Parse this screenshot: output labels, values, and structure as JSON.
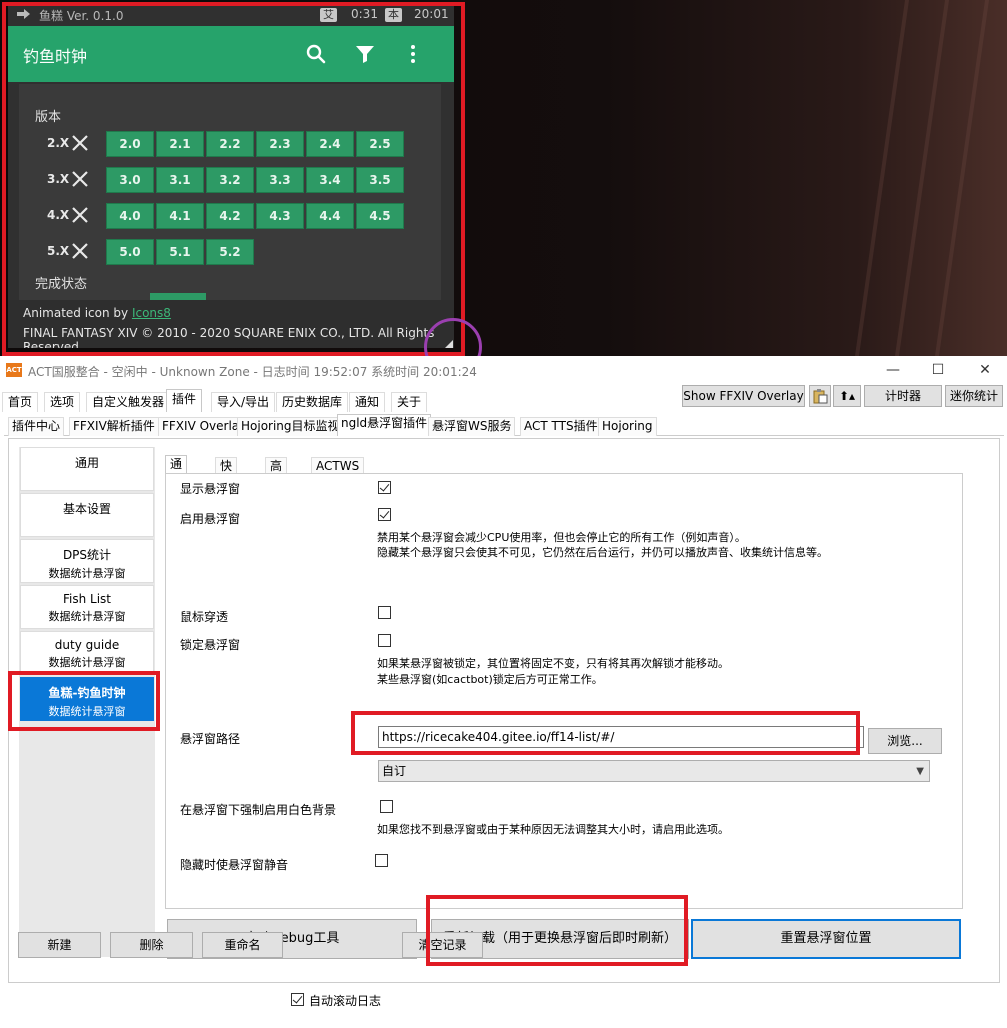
{
  "overlay": {
    "app_title": "鱼糕 Ver. 0.1.0",
    "tag_et": "艾",
    "time_et": "0:31",
    "tag_lt": "本",
    "time_lt": "20:01",
    "header_title": "钓鱼时钟",
    "version_label": "版本",
    "version_rows": [
      {
        "name": "2.X",
        "versions": [
          "2.0",
          "2.1",
          "2.2",
          "2.3",
          "2.4",
          "2.5"
        ]
      },
      {
        "name": "3.X",
        "versions": [
          "3.0",
          "3.1",
          "3.2",
          "3.3",
          "3.4",
          "3.5"
        ]
      },
      {
        "name": "4.X",
        "versions": [
          "4.0",
          "4.1",
          "4.2",
          "4.3",
          "4.4",
          "4.5"
        ]
      },
      {
        "name": "5.X",
        "versions": [
          "5.0",
          "5.1",
          "5.2"
        ]
      }
    ],
    "completion_label": "完成状态",
    "footer_prefix": "Animated icon by ",
    "footer_link": "Icons8",
    "footer_copyright": "FINAL FANTASY XIV © 2010 - 2020 SQUARE ENIX CO., LTD. All Rights Reserved.",
    "icons": [
      "arrow-right-icon",
      "search-icon",
      "filter-icon",
      "more-vert-icon",
      "close-icon",
      "resize-grip-icon"
    ],
    "accent_color": "#26a36b"
  },
  "act": {
    "window_title": "ACT国服整合 - 空闲中 - Unknown Zone - 日志时间 19:52:07 系统时间 20:01:24",
    "logo_text": "ACT",
    "menu_tabs": [
      "首页",
      "选项",
      "自定义触发器",
      "插件",
      "导入/导出",
      "历史数据库",
      "通知",
      "关于"
    ],
    "right_buttons": {
      "show_overlay": "Show FFXIV Overlay",
      "timer": "计时器",
      "mini": "迷你统计"
    },
    "plugin_tabs": [
      "插件中心",
      "FFXIV解析插件",
      "FFXIV Overlay",
      "Hojoring目标监视",
      "ngld悬浮窗插件",
      "悬浮窗WS服务",
      "ACT TTS插件",
      "Hojoring"
    ],
    "overlays": [
      {
        "title": "通用",
        "subtitle": ""
      },
      {
        "title": "基本设置",
        "subtitle": ""
      },
      {
        "title": "DPS统计",
        "subtitle": "数据统计悬浮窗"
      },
      {
        "title": "Fish List",
        "subtitle": "数据统计悬浮窗"
      },
      {
        "title": "duty guide",
        "subtitle": "数据统计悬浮窗"
      },
      {
        "title": "鱼糕-钓鱼时钟",
        "subtitle": "数据统计悬浮窗"
      }
    ],
    "inner_tabs": [
      "通用",
      "快捷键",
      "高级",
      "ACTWS"
    ],
    "settings": {
      "show_overlay_label": "显示悬浮窗",
      "enable_overlay_label": "启用悬浮窗",
      "enable_desc_1": "禁用某个悬浮窗会减少CPU使用率，但也会停止它的所有工作（例如声音）。",
      "enable_desc_2": "隐藏某个悬浮窗只会使其不可见，它仍然在后台运行，并仍可以播放声音、收集统计信息等。",
      "click_through_label": "鼠标穿透",
      "lock_label": "锁定悬浮窗",
      "lock_desc_1": "如果某悬浮窗被锁定，其位置将固定不变，只有将其再次解锁才能移动。",
      "lock_desc_2": "某些悬浮窗(如cactbot)锁定后方可正常工作。",
      "path_label": "悬浮窗路径",
      "path_value": "https://ricecake404.gitee.io/ff14-list/#/",
      "browse_label": "浏览...",
      "mode_value": "自订",
      "white_bg_label": "在悬浮窗下强制启用白色背景",
      "white_bg_desc": "如果您找不到悬浮窗或由于某种原因无法调整其大小时，请启用此选项。",
      "mute_label": "隐藏时使悬浮窗静音"
    },
    "bottom_buttons": {
      "debug": "启动Debug工具",
      "reload": "重新加载（用于更换悬浮窗后即时刷新）",
      "reset_pos": "重置悬浮窗位置"
    },
    "footer": {
      "new": "新建",
      "delete": "删除",
      "rename": "重命名",
      "autoscroll": "自动滚动日志",
      "clear": "清空记录"
    },
    "selection_color": "#0a78d7",
    "highlight_color": "#e01b24"
  }
}
